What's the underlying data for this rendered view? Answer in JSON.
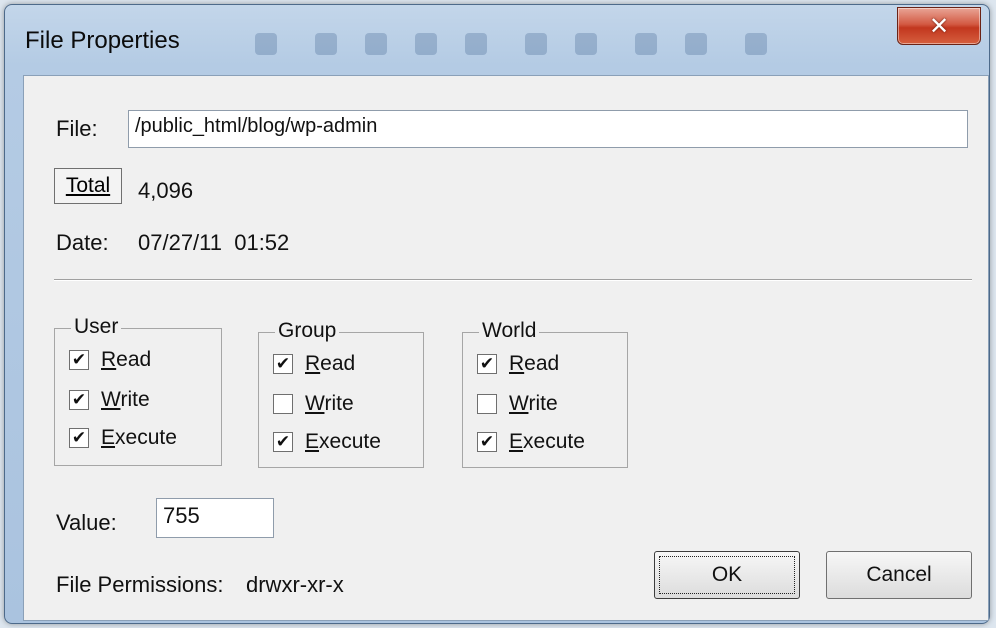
{
  "window": {
    "title": "File Properties",
    "close_glyph": "✕"
  },
  "file": {
    "label": "File:",
    "path": "/public_html/blog/wp-admin"
  },
  "total": {
    "button_label": "Total",
    "value": "4,096"
  },
  "date": {
    "label": "Date:",
    "value": "07/27/11  01:52"
  },
  "groups": [
    {
      "title": "User",
      "options": [
        {
          "label": "Read",
          "checked": true
        },
        {
          "label": "Write",
          "checked": true
        },
        {
          "label": "Execute",
          "checked": true
        }
      ]
    },
    {
      "title": "Group",
      "options": [
        {
          "label": "Read",
          "checked": true
        },
        {
          "label": "Write",
          "checked": false
        },
        {
          "label": "Execute",
          "checked": true
        }
      ]
    },
    {
      "title": "World",
      "options": [
        {
          "label": "Read",
          "checked": true
        },
        {
          "label": "Write",
          "checked": false
        },
        {
          "label": "Execute",
          "checked": true
        }
      ]
    }
  ],
  "value": {
    "label": "Value:",
    "field": "755"
  },
  "permissions": {
    "label": "File Permissions:",
    "value": "drwxr-xr-x"
  },
  "buttons": {
    "ok": "OK",
    "cancel": "Cancel"
  },
  "check_glyph": "✔",
  "colors": {
    "close_button": "#c2371f",
    "dialog_face": "#f0f0f0",
    "frame": "#b4cbe4"
  }
}
